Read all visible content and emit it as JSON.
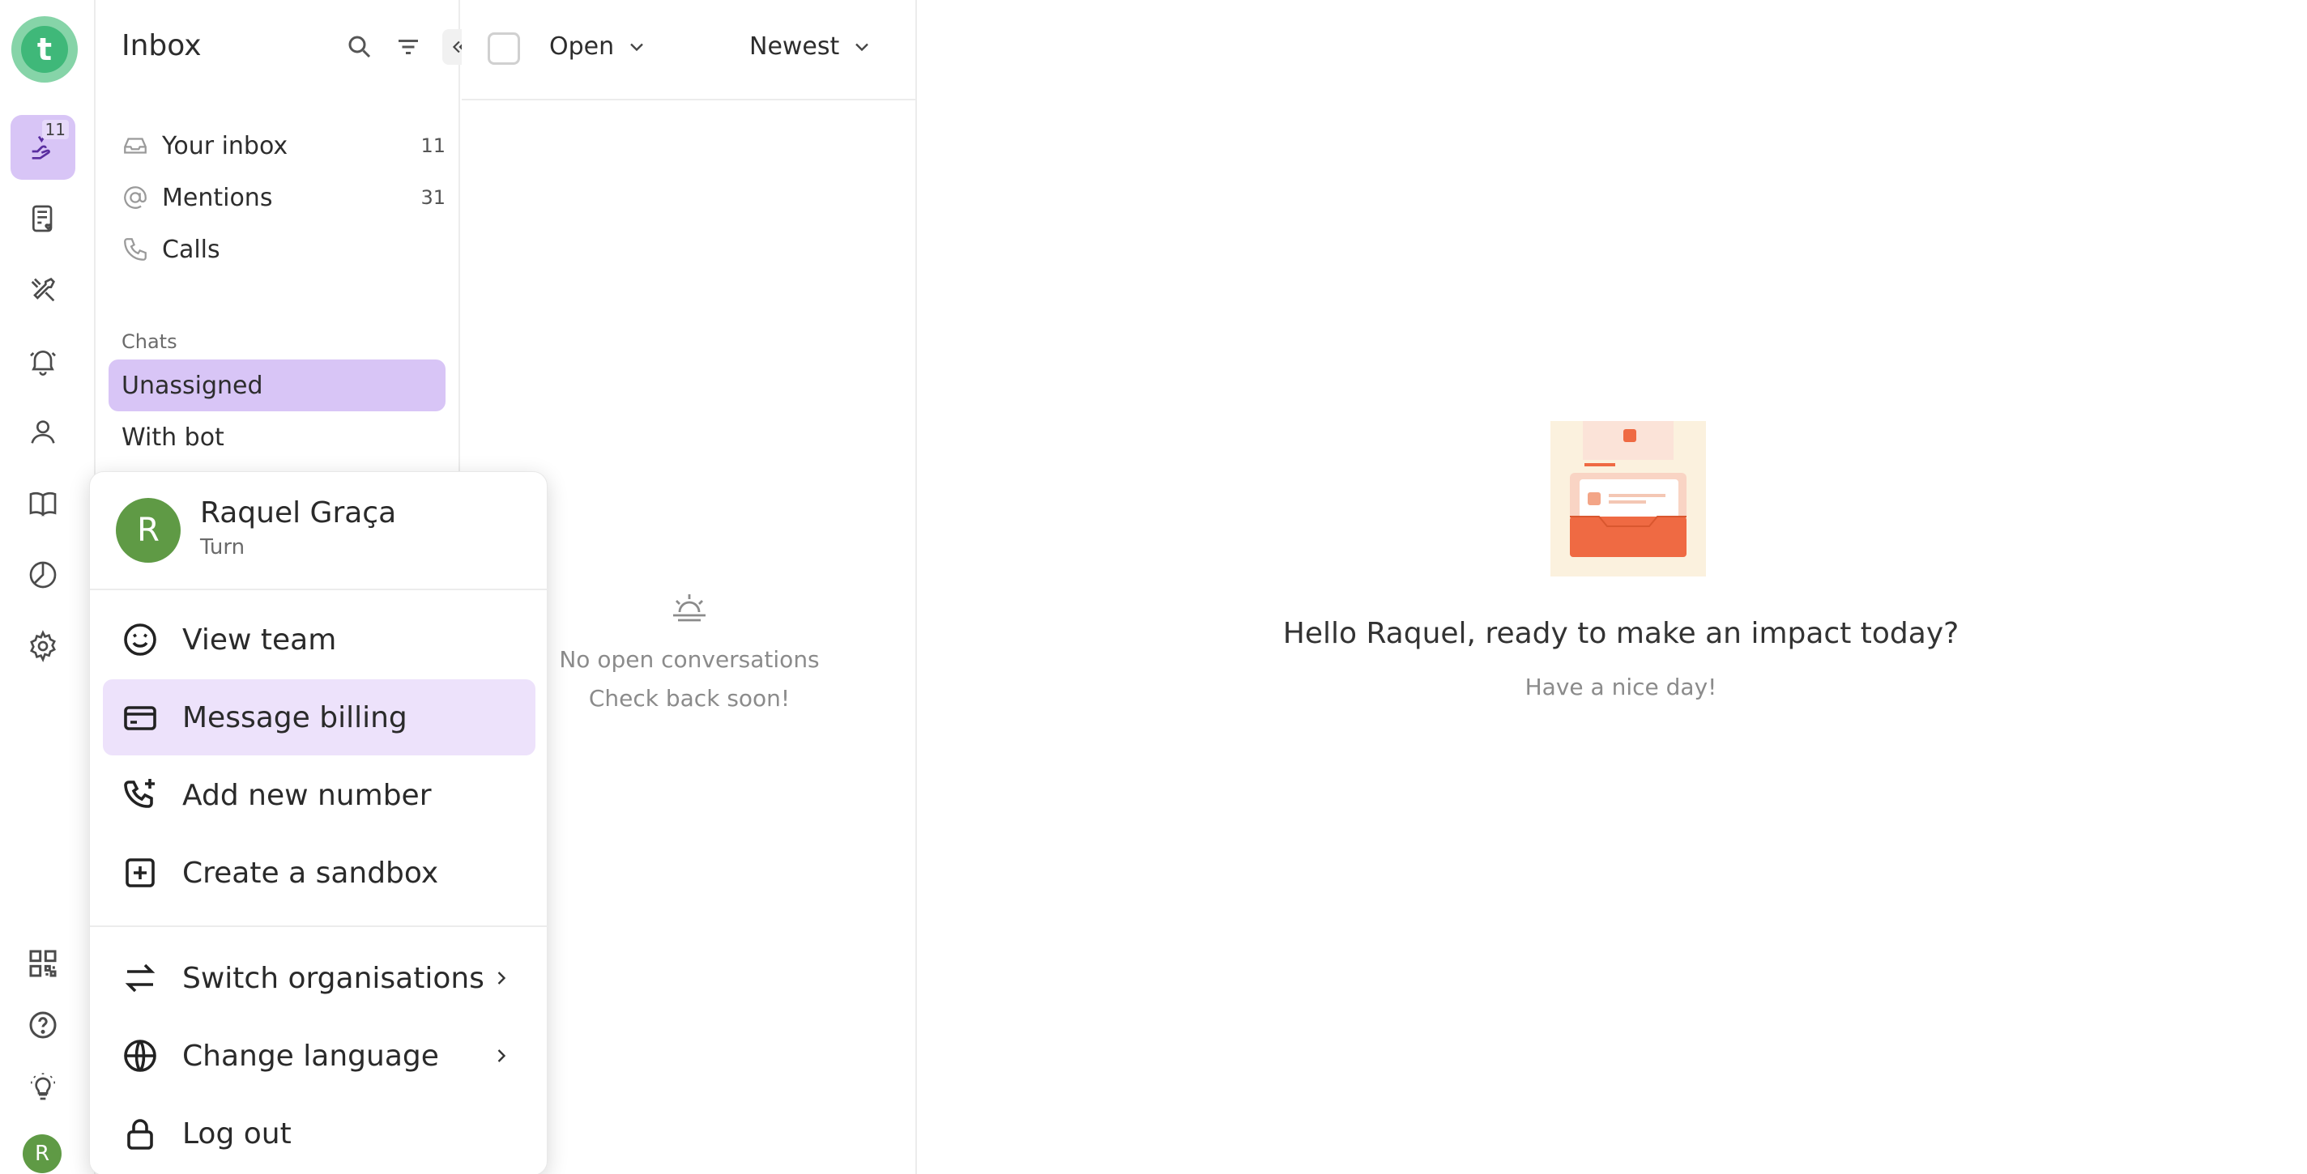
{
  "rail": {
    "brand_letter": "t",
    "inbox_badge": "11",
    "user_initial": "R"
  },
  "panel": {
    "title": "Inbox",
    "nav": [
      {
        "label": "Your inbox",
        "count": "11"
      },
      {
        "label": "Mentions",
        "count": "31"
      },
      {
        "label": "Calls",
        "count": ""
      }
    ],
    "section_chats": "Chats",
    "chats": [
      {
        "label": "Unassigned",
        "selected": true
      },
      {
        "label": "With bot",
        "selected": false
      }
    ]
  },
  "conversations": {
    "status_filter": "Open",
    "sort": "Newest",
    "empty_title": "No open conversations",
    "empty_subtitle": "Check back soon!"
  },
  "main": {
    "greeting": "Hello Raquel, ready to make an impact today?",
    "subtitle": "Have a nice day!"
  },
  "popup": {
    "user_initial": "R",
    "user_name": "Raquel Graça",
    "org_name": "Turn",
    "items": [
      {
        "label": "View team",
        "icon": "smile-icon"
      },
      {
        "label": "Message billing",
        "icon": "credit-card-icon"
      },
      {
        "label": "Add new number",
        "icon": "phone-plus-icon"
      },
      {
        "label": "Create a sandbox",
        "icon": "plus-square-icon"
      },
      {
        "label": "Switch organisations",
        "icon": "swap-icon"
      },
      {
        "label": "Change language",
        "icon": "globe-icon"
      },
      {
        "label": "Log out",
        "icon": "lock-icon"
      }
    ]
  },
  "colors": {
    "accent": "#d8c5f6",
    "accent_light": "#ede2fb",
    "brand_green": "#3fb879",
    "avatar_green": "#5f9a45",
    "illustration_orange": "#ef6a43"
  }
}
